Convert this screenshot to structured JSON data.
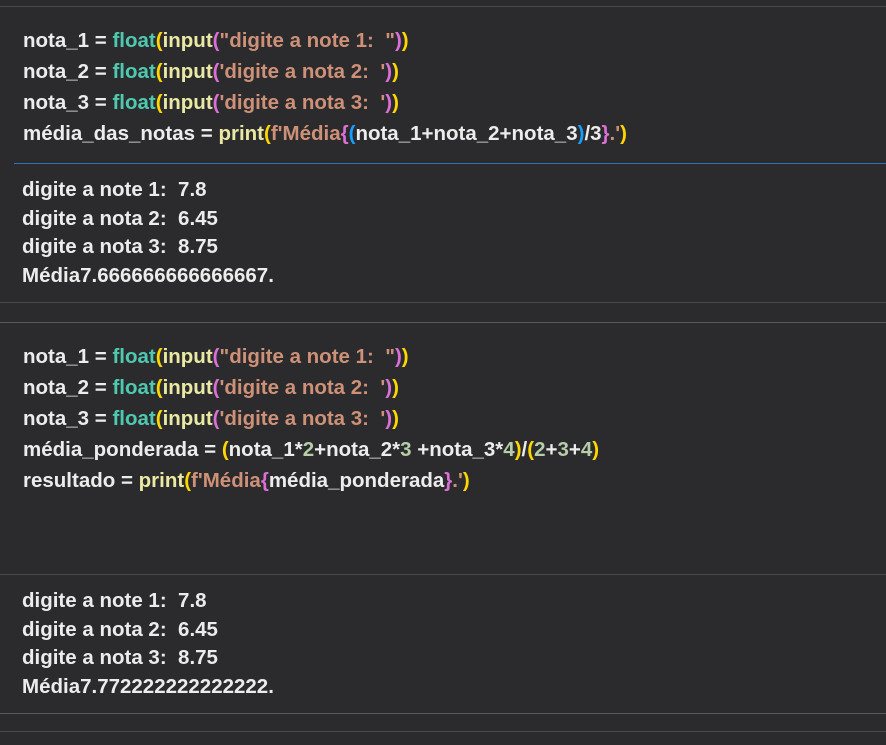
{
  "cells": [
    {
      "type": "code",
      "lines": [
        [
          {
            "t": "nota_1",
            "c": "var"
          },
          {
            "t": " = ",
            "c": "op"
          },
          {
            "t": "float",
            "c": "func"
          },
          {
            "t": "(",
            "c": "paren1"
          },
          {
            "t": "input",
            "c": "builtin"
          },
          {
            "t": "(",
            "c": "paren2"
          },
          {
            "t": "\"digite a note 1:  \"",
            "c": "str"
          },
          {
            "t": ")",
            "c": "paren2"
          },
          {
            "t": ")",
            "c": "paren1"
          }
        ],
        [
          {
            "t": "nota_2",
            "c": "var"
          },
          {
            "t": " = ",
            "c": "op"
          },
          {
            "t": "float",
            "c": "func"
          },
          {
            "t": "(",
            "c": "paren1"
          },
          {
            "t": "input",
            "c": "builtin"
          },
          {
            "t": "(",
            "c": "paren2"
          },
          {
            "t": "'digite a nota 2:  '",
            "c": "str"
          },
          {
            "t": ")",
            "c": "paren2"
          },
          {
            "t": ")",
            "c": "paren1"
          }
        ],
        [
          {
            "t": "nota_3",
            "c": "var"
          },
          {
            "t": " = ",
            "c": "op"
          },
          {
            "t": "float",
            "c": "func"
          },
          {
            "t": "(",
            "c": "paren1"
          },
          {
            "t": "input",
            "c": "builtin"
          },
          {
            "t": "(",
            "c": "paren2"
          },
          {
            "t": "'digite a nota 3:  '",
            "c": "str"
          },
          {
            "t": ")",
            "c": "paren2"
          },
          {
            "t": ")",
            "c": "paren1"
          }
        ],
        [
          {
            "t": "média_das_notas",
            "c": "var"
          },
          {
            "t": " = ",
            "c": "op"
          },
          {
            "t": "print",
            "c": "builtin"
          },
          {
            "t": "(",
            "c": "paren1"
          },
          {
            "t": "f'Média",
            "c": "str"
          },
          {
            "t": "{",
            "c": "paren2"
          },
          {
            "t": "(",
            "c": "paren3"
          },
          {
            "t": "nota_1+nota_2+nota_3",
            "c": "var"
          },
          {
            "t": ")",
            "c": "paren3"
          },
          {
            "t": "/3",
            "c": "var"
          },
          {
            "t": "}",
            "c": "paren2"
          },
          {
            "t": ".'",
            "c": "str"
          },
          {
            "t": ")",
            "c": "paren1"
          }
        ]
      ]
    },
    {
      "type": "output",
      "lines": [
        "digite a note 1:  7.8",
        "digite a nota 2:  6.45",
        "digite a nota 3:  8.75",
        "Média7.666666666666667."
      ]
    },
    {
      "type": "code",
      "lines": [
        [
          {
            "t": "nota_1",
            "c": "var"
          },
          {
            "t": " = ",
            "c": "op"
          },
          {
            "t": "float",
            "c": "func"
          },
          {
            "t": "(",
            "c": "paren1"
          },
          {
            "t": "input",
            "c": "builtin"
          },
          {
            "t": "(",
            "c": "paren2"
          },
          {
            "t": "\"digite a note 1:  \"",
            "c": "str"
          },
          {
            "t": ")",
            "c": "paren2"
          },
          {
            "t": ")",
            "c": "paren1"
          }
        ],
        [
          {
            "t": "nota_2",
            "c": "var"
          },
          {
            "t": " = ",
            "c": "op"
          },
          {
            "t": "float",
            "c": "func"
          },
          {
            "t": "(",
            "c": "paren1"
          },
          {
            "t": "input",
            "c": "builtin"
          },
          {
            "t": "(",
            "c": "paren2"
          },
          {
            "t": "'digite a nota 2:  '",
            "c": "str"
          },
          {
            "t": ")",
            "c": "paren2"
          },
          {
            "t": ")",
            "c": "paren1"
          }
        ],
        [
          {
            "t": "nota_3",
            "c": "var"
          },
          {
            "t": " = ",
            "c": "op"
          },
          {
            "t": "float",
            "c": "func"
          },
          {
            "t": "(",
            "c": "paren1"
          },
          {
            "t": "input",
            "c": "builtin"
          },
          {
            "t": "(",
            "c": "paren2"
          },
          {
            "t": "'digite a nota 3:  '",
            "c": "str"
          },
          {
            "t": ")",
            "c": "paren2"
          },
          {
            "t": ")",
            "c": "paren1"
          }
        ],
        [
          {
            "t": "média_ponderada",
            "c": "var"
          },
          {
            "t": " = ",
            "c": "op"
          },
          {
            "t": "(",
            "c": "paren1"
          },
          {
            "t": "nota_1*",
            "c": "var"
          },
          {
            "t": "2",
            "c": "num"
          },
          {
            "t": "+nota_2*",
            "c": "var"
          },
          {
            "t": "3",
            "c": "num"
          },
          {
            "t": " +nota_3*",
            "c": "var"
          },
          {
            "t": "4",
            "c": "num"
          },
          {
            "t": ")",
            "c": "paren1"
          },
          {
            "t": "/",
            "c": "op"
          },
          {
            "t": "(",
            "c": "paren1"
          },
          {
            "t": "2",
            "c": "num"
          },
          {
            "t": "+",
            "c": "op"
          },
          {
            "t": "3",
            "c": "num"
          },
          {
            "t": "+",
            "c": "op"
          },
          {
            "t": "4",
            "c": "num"
          },
          {
            "t": ")",
            "c": "paren1"
          }
        ],
        [
          {
            "t": "resultado",
            "c": "var"
          },
          {
            "t": " = ",
            "c": "op"
          },
          {
            "t": "print",
            "c": "builtin"
          },
          {
            "t": "(",
            "c": "paren1"
          },
          {
            "t": "f'Média",
            "c": "str"
          },
          {
            "t": "{",
            "c": "paren2"
          },
          {
            "t": "média_ponderada",
            "c": "var"
          },
          {
            "t": "}",
            "c": "paren2"
          },
          {
            "t": ".'",
            "c": "str"
          },
          {
            "t": ")",
            "c": "paren1"
          }
        ]
      ]
    },
    {
      "type": "output",
      "lines": [
        "digite a note 1:  7.8",
        "digite a nota 2:  6.45",
        "digite a nota 3:  8.75",
        "Média7.772222222222222."
      ]
    }
  ]
}
